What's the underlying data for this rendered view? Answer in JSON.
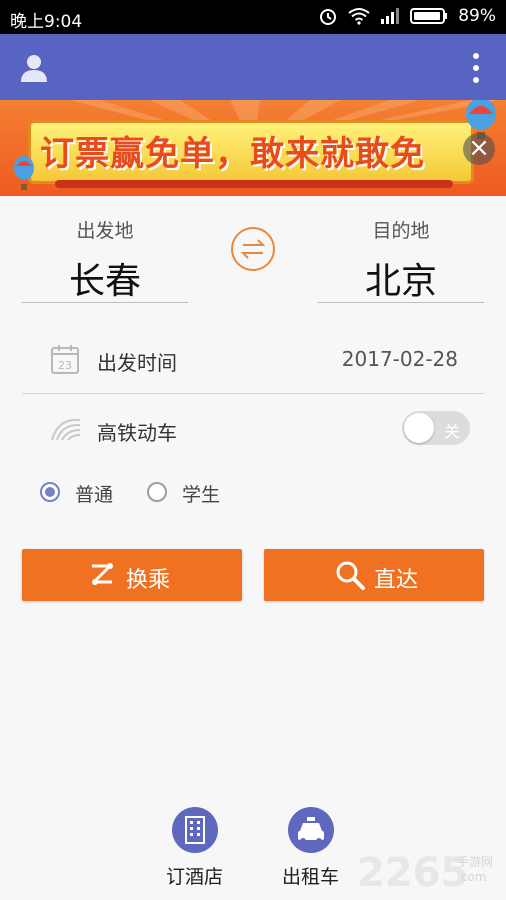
{
  "status_bar": {
    "time": "晚上9:04",
    "battery": "89%"
  },
  "app_bar": {
    "icons": [
      "user-icon",
      "more-vert-icon"
    ]
  },
  "banner": {
    "text": "订票赢免单，敢来就敢免"
  },
  "route": {
    "from_label": "出发地",
    "from_city": "长春",
    "to_label": "目的地",
    "to_city": "北京"
  },
  "date_row": {
    "label": "出发时间",
    "value": "2017-02-28",
    "calendar_day": "23"
  },
  "highspeed_row": {
    "label": "高铁动车",
    "toggle_text": "关",
    "enabled": false
  },
  "ticket_type": {
    "options": [
      "普通",
      "学生"
    ],
    "selected": "普通"
  },
  "actions": {
    "transfer": "换乘",
    "direct": "直达"
  },
  "bottom_nav": {
    "hotel": "订酒店",
    "taxi": "出租车"
  },
  "watermark": {
    "number": "2265",
    "suffix_top": "手游网",
    "suffix_bottom": ".com"
  },
  "colors": {
    "primary": "#5764c1",
    "accent": "#f07122",
    "radio_selected": "#7a80c7"
  }
}
